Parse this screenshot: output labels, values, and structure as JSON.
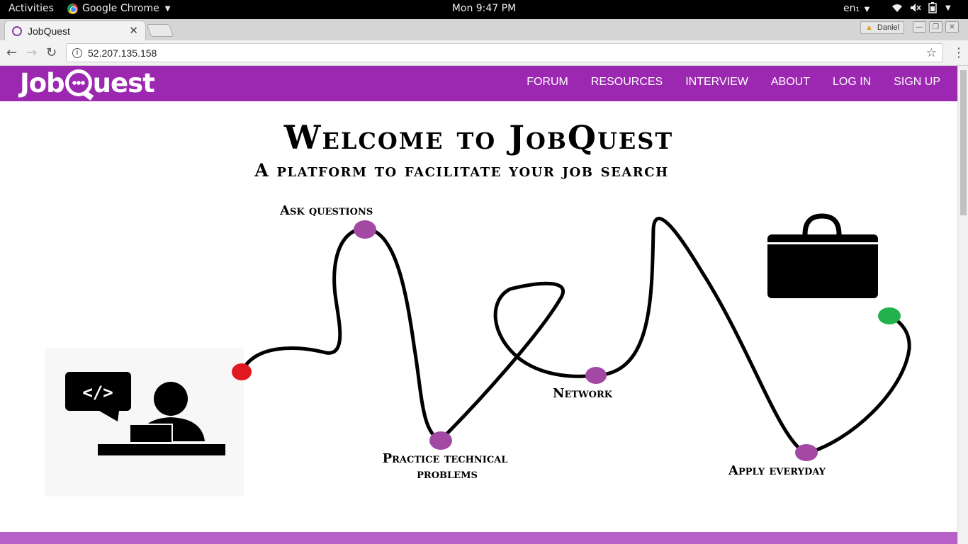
{
  "os": {
    "activities": "Activities",
    "app_name": "Google Chrome",
    "clock": "Mon  9:47 PM",
    "lang": "en₁"
  },
  "browser": {
    "tab_title": "JobQuest",
    "profile_name": "Daniel",
    "url": "52.207.135.158"
  },
  "site": {
    "logo_text": [
      "Job",
      "uest"
    ],
    "nav": [
      "FORUM",
      "RESOURCES",
      "INTERVIEW",
      "ABOUT",
      "LOG IN",
      "SIGN UP"
    ],
    "title": "Welcome to JobQuest",
    "subtitle": "A platform to facilitate your job search",
    "steps": {
      "ask": "Ask questions",
      "practice_1": "Practice technical",
      "practice_2": "problems",
      "network": "Network",
      "apply": "Apply everyday"
    },
    "colors": {
      "brand": "#9c27b0",
      "footer": "#b760c8",
      "start_dot": "#e0191f",
      "step_dot": "#a349a4",
      "end_dot": "#22b14c"
    },
    "icons": [
      "code-speech-bubble-icon",
      "developer-at-laptop-icon",
      "briefcase-icon"
    ]
  }
}
